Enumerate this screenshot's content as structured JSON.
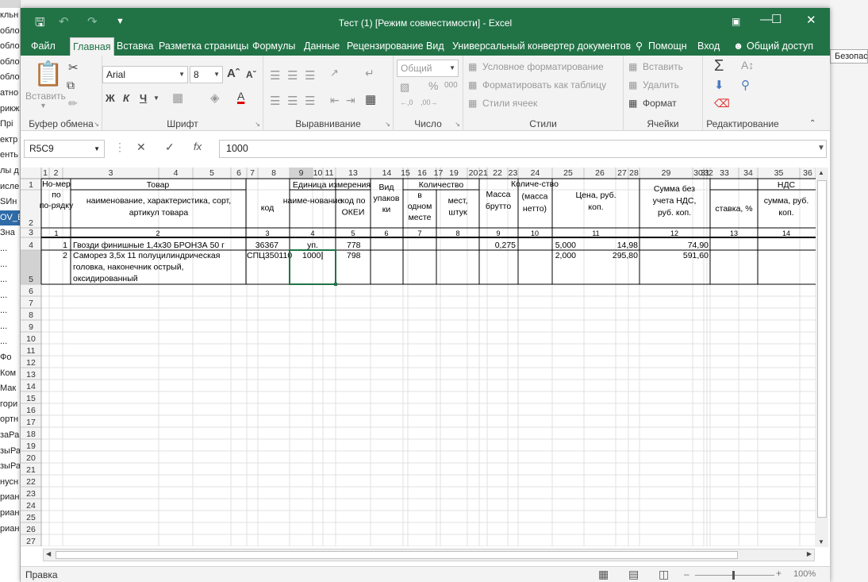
{
  "window": {
    "title": "Тест (1)  [Режим совместимости] - Excel"
  },
  "tabs": [
    "Файл",
    "Главная",
    "Вставка",
    "Разметка страницы",
    "Формулы",
    "Данные",
    "Рецензирование",
    "Вид",
    "Универсальный конвертер документов"
  ],
  "tell_me": "Помощн",
  "login": "Вход",
  "share": "Общий доступ",
  "ribbon": {
    "clipboard": {
      "label": "Буфер обмена",
      "paste": "Вставить"
    },
    "font": {
      "label": "Шрифт",
      "name": "Arial",
      "size": "8",
      "bold": "Ж",
      "italic": "К",
      "underline": "Ч"
    },
    "alignment": {
      "label": "Выравнивание"
    },
    "number": {
      "label": "Число",
      "format": "Общий"
    },
    "styles": {
      "label": "Стили",
      "cond": "Условное форматирование",
      "table": "Форматировать как таблицу",
      "cell": "Стили ячеек"
    },
    "cells": {
      "label": "Ячейки",
      "insert": "Вставить",
      "delete": "Удалить",
      "format": "Формат"
    },
    "editing": {
      "label": "Редактирование"
    }
  },
  "formula": {
    "namebox": "R5C9",
    "value": "1000"
  },
  "sheet": {
    "col_headers": [
      "1",
      "2",
      "3",
      "4",
      "5",
      "6",
      "7",
      "8",
      "9",
      "10",
      "11",
      "13",
      "14",
      "15",
      "16",
      "17",
      "19",
      "20",
      "21",
      "22",
      "23",
      "24",
      "25",
      "26",
      "27",
      "28",
      "29",
      "30",
      "31",
      "32",
      "33",
      "34",
      "35",
      "36"
    ],
    "row_headers": [
      "1",
      "2",
      "3",
      "4",
      "5",
      "6",
      "7",
      "8",
      "9",
      "10",
      "11",
      "12",
      "13",
      "14",
      "15",
      "16",
      "17",
      "18",
      "19",
      "20",
      "21",
      "22",
      "23",
      "24",
      "25",
      "26",
      "27"
    ],
    "hdr": {
      "nomer": "Но-мер по по-рядку",
      "tovar": "Товар",
      "naim": "наименование, характеристика, сорт, артикул товара",
      "kod": "код",
      "ed": "Единица измерения",
      "ed_naim": "наиме-нование",
      "okei": "код по ОКЕИ",
      "vid": "Вид упаков ки",
      "kol": "Количество",
      "v_odnom": "в одном месте",
      "mest": "мест, штук",
      "massa": "Масса брутто",
      "kol_netto": "Количе-ство (масса нетто)",
      "cena": "Цена, руб. коп.",
      "summa": "Сумма без учета НДС, руб. коп.",
      "nds": "НДС",
      "stavka": "ставка, %",
      "summa_nds": "сумма, руб. коп."
    },
    "nums": [
      "1",
      "2",
      "3",
      "4",
      "5",
      "6",
      "7",
      "8",
      "9",
      "10",
      "11",
      "12",
      "13",
      "14"
    ],
    "rows": [
      {
        "n": "1",
        "name": "Гвозди финишные 1,4х30 БРОНЗА 50 г",
        "kod": "36367",
        "ed": "уп.",
        "okei": "778",
        "massa": "0,275",
        "kol": "5,000",
        "cena": "14,98",
        "sum": "74,90"
      },
      {
        "n": "2",
        "name": "Саморез 3,5х 11 полуцилиндрическая головка, наконечник острый, оксидированный",
        "kod": "СПЦ350110",
        "ed": "1000",
        "okei": "798",
        "massa": "",
        "kol": "2,000",
        "cena": "295,80",
        "sum": "591,60"
      }
    ]
  },
  "status": {
    "text": "Правка",
    "zoom": "100%"
  },
  "background": {
    "left_rows": [
      "кльн",
      "облон",
      "облон",
      "облон",
      "облон",
      "атно",
      "рикж",
      "Прі",
      "ектр",
      "енть",
      "лы д",
      "исле",
      "SИн",
      "OV_B",
      "Зна",
      "...",
      "...",
      "...",
      "...",
      "...",
      "...",
      "...",
      "Фо",
      "Ком",
      "Мак",
      "гори",
      "ортн",
      "заРа",
      "зыРа",
      "зыРа",
      "нусн",
      "риан",
      "риан",
      "риан"
    ],
    "right_text": "Безопас"
  }
}
